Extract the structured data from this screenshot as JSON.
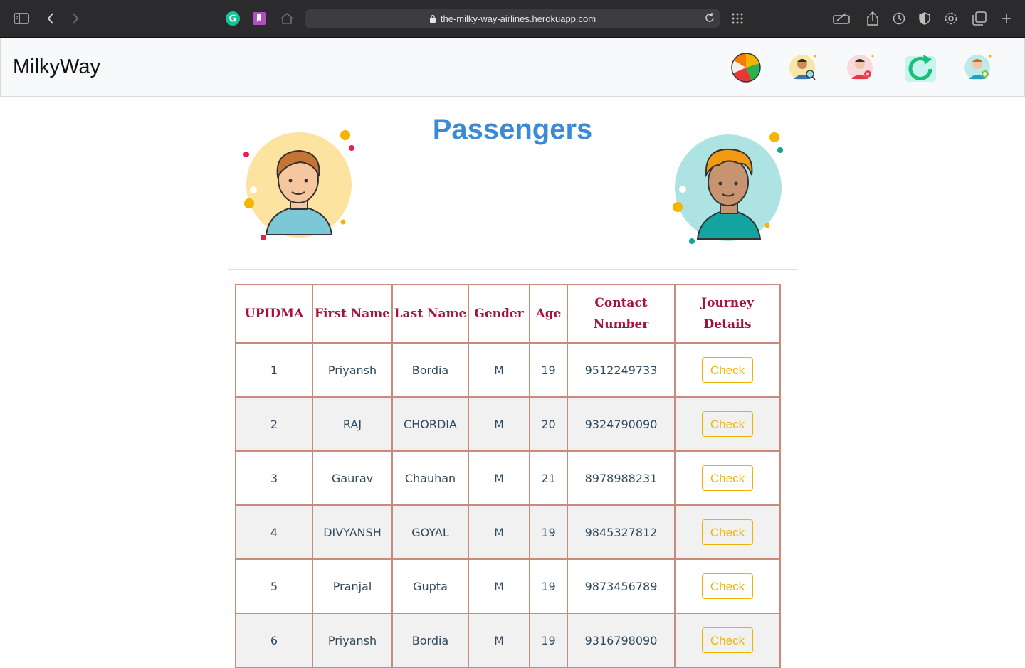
{
  "browser": {
    "url": "the-milky-way-airlines.herokuapp.com"
  },
  "navbar": {
    "brand": "MilkyWay",
    "icons": [
      "pie-chart-icon",
      "search-user-icon",
      "remove-user-icon",
      "refresh-icon",
      "add-user-icon"
    ]
  },
  "page": {
    "title": "Passengers"
  },
  "table": {
    "headers": [
      "UPIDMA",
      "First Name",
      "Last Name",
      "Gender",
      "Age",
      "Contact Number",
      "Journey Details"
    ],
    "rows": [
      {
        "id": "1",
        "first": "Priyansh",
        "last": "Bordia",
        "gender": "M",
        "age": "19",
        "contact": "9512249733",
        "action": "Check"
      },
      {
        "id": "2",
        "first": "RAJ",
        "last": "CHORDIA",
        "gender": "M",
        "age": "20",
        "contact": "9324790090",
        "action": "Check"
      },
      {
        "id": "3",
        "first": "Gaurav",
        "last": "Chauhan",
        "gender": "M",
        "age": "21",
        "contact": "8978988231",
        "action": "Check"
      },
      {
        "id": "4",
        "first": "DIVYANSH",
        "last": "GOYAL",
        "gender": "M",
        "age": "19",
        "contact": "9845327812",
        "action": "Check"
      },
      {
        "id": "5",
        "first": "Pranjal",
        "last": "Gupta",
        "gender": "M",
        "age": "19",
        "contact": "9873456789",
        "action": "Check"
      },
      {
        "id": "6",
        "first": "Priyansh",
        "last": "Bordia",
        "gender": "M",
        "age": "19",
        "contact": "9316798090",
        "action": "Check"
      }
    ]
  },
  "colors": {
    "title": "#3a8bd3",
    "header_text": "#a5123a",
    "border": "#c98a7a",
    "button": "#f0b400"
  }
}
